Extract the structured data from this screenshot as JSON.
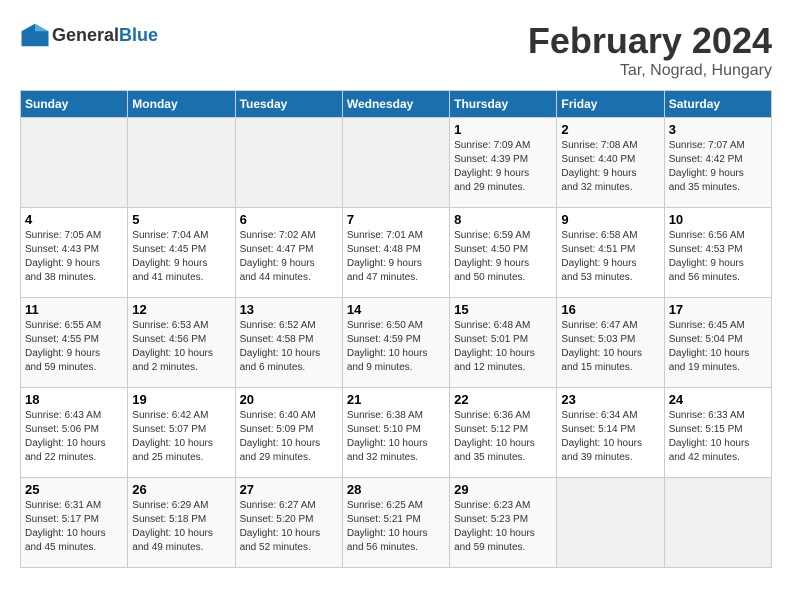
{
  "header": {
    "logo_general": "General",
    "logo_blue": "Blue",
    "month_year": "February 2024",
    "location": "Tar, Nograd, Hungary"
  },
  "columns": [
    "Sunday",
    "Monday",
    "Tuesday",
    "Wednesday",
    "Thursday",
    "Friday",
    "Saturday"
  ],
  "weeks": [
    [
      {
        "day": "",
        "info": ""
      },
      {
        "day": "",
        "info": ""
      },
      {
        "day": "",
        "info": ""
      },
      {
        "day": "",
        "info": ""
      },
      {
        "day": "1",
        "info": "Sunrise: 7:09 AM\nSunset: 4:39 PM\nDaylight: 9 hours\nand 29 minutes."
      },
      {
        "day": "2",
        "info": "Sunrise: 7:08 AM\nSunset: 4:40 PM\nDaylight: 9 hours\nand 32 minutes."
      },
      {
        "day": "3",
        "info": "Sunrise: 7:07 AM\nSunset: 4:42 PM\nDaylight: 9 hours\nand 35 minutes."
      }
    ],
    [
      {
        "day": "4",
        "info": "Sunrise: 7:05 AM\nSunset: 4:43 PM\nDaylight: 9 hours\nand 38 minutes."
      },
      {
        "day": "5",
        "info": "Sunrise: 7:04 AM\nSunset: 4:45 PM\nDaylight: 9 hours\nand 41 minutes."
      },
      {
        "day": "6",
        "info": "Sunrise: 7:02 AM\nSunset: 4:47 PM\nDaylight: 9 hours\nand 44 minutes."
      },
      {
        "day": "7",
        "info": "Sunrise: 7:01 AM\nSunset: 4:48 PM\nDaylight: 9 hours\nand 47 minutes."
      },
      {
        "day": "8",
        "info": "Sunrise: 6:59 AM\nSunset: 4:50 PM\nDaylight: 9 hours\nand 50 minutes."
      },
      {
        "day": "9",
        "info": "Sunrise: 6:58 AM\nSunset: 4:51 PM\nDaylight: 9 hours\nand 53 minutes."
      },
      {
        "day": "10",
        "info": "Sunrise: 6:56 AM\nSunset: 4:53 PM\nDaylight: 9 hours\nand 56 minutes."
      }
    ],
    [
      {
        "day": "11",
        "info": "Sunrise: 6:55 AM\nSunset: 4:55 PM\nDaylight: 9 hours\nand 59 minutes."
      },
      {
        "day": "12",
        "info": "Sunrise: 6:53 AM\nSunset: 4:56 PM\nDaylight: 10 hours\nand 2 minutes."
      },
      {
        "day": "13",
        "info": "Sunrise: 6:52 AM\nSunset: 4:58 PM\nDaylight: 10 hours\nand 6 minutes."
      },
      {
        "day": "14",
        "info": "Sunrise: 6:50 AM\nSunset: 4:59 PM\nDaylight: 10 hours\nand 9 minutes."
      },
      {
        "day": "15",
        "info": "Sunrise: 6:48 AM\nSunset: 5:01 PM\nDaylight: 10 hours\nand 12 minutes."
      },
      {
        "day": "16",
        "info": "Sunrise: 6:47 AM\nSunset: 5:03 PM\nDaylight: 10 hours\nand 15 minutes."
      },
      {
        "day": "17",
        "info": "Sunrise: 6:45 AM\nSunset: 5:04 PM\nDaylight: 10 hours\nand 19 minutes."
      }
    ],
    [
      {
        "day": "18",
        "info": "Sunrise: 6:43 AM\nSunset: 5:06 PM\nDaylight: 10 hours\nand 22 minutes."
      },
      {
        "day": "19",
        "info": "Sunrise: 6:42 AM\nSunset: 5:07 PM\nDaylight: 10 hours\nand 25 minutes."
      },
      {
        "day": "20",
        "info": "Sunrise: 6:40 AM\nSunset: 5:09 PM\nDaylight: 10 hours\nand 29 minutes."
      },
      {
        "day": "21",
        "info": "Sunrise: 6:38 AM\nSunset: 5:10 PM\nDaylight: 10 hours\nand 32 minutes."
      },
      {
        "day": "22",
        "info": "Sunrise: 6:36 AM\nSunset: 5:12 PM\nDaylight: 10 hours\nand 35 minutes."
      },
      {
        "day": "23",
        "info": "Sunrise: 6:34 AM\nSunset: 5:14 PM\nDaylight: 10 hours\nand 39 minutes."
      },
      {
        "day": "24",
        "info": "Sunrise: 6:33 AM\nSunset: 5:15 PM\nDaylight: 10 hours\nand 42 minutes."
      }
    ],
    [
      {
        "day": "25",
        "info": "Sunrise: 6:31 AM\nSunset: 5:17 PM\nDaylight: 10 hours\nand 45 minutes."
      },
      {
        "day": "26",
        "info": "Sunrise: 6:29 AM\nSunset: 5:18 PM\nDaylight: 10 hours\nand 49 minutes."
      },
      {
        "day": "27",
        "info": "Sunrise: 6:27 AM\nSunset: 5:20 PM\nDaylight: 10 hours\nand 52 minutes."
      },
      {
        "day": "28",
        "info": "Sunrise: 6:25 AM\nSunset: 5:21 PM\nDaylight: 10 hours\nand 56 minutes."
      },
      {
        "day": "29",
        "info": "Sunrise: 6:23 AM\nSunset: 5:23 PM\nDaylight: 10 hours\nand 59 minutes."
      },
      {
        "day": "",
        "info": ""
      },
      {
        "day": "",
        "info": ""
      }
    ]
  ]
}
